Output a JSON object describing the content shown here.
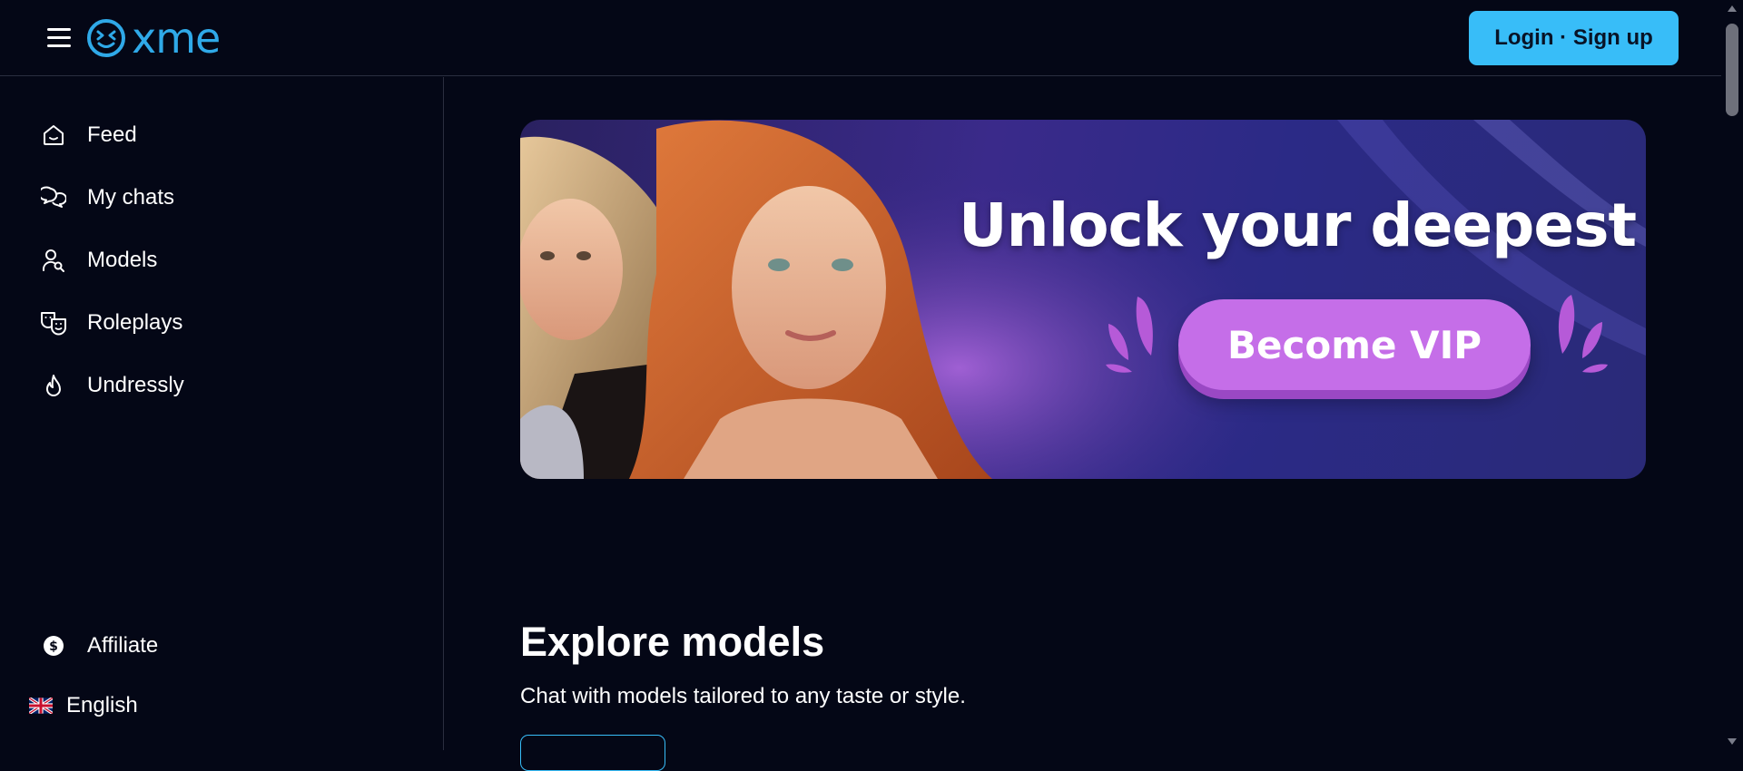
{
  "header": {
    "logo_text": "xme",
    "login_label": "Login · Sign up"
  },
  "sidebar": {
    "items": [
      {
        "label": "Feed",
        "icon": "home-icon"
      },
      {
        "label": "My chats",
        "icon": "chat-bubbles-icon"
      },
      {
        "label": "Models",
        "icon": "user-search-icon"
      },
      {
        "label": "Roleplays",
        "icon": "theater-masks-icon"
      },
      {
        "label": "Undressly",
        "icon": "flame-icon"
      }
    ],
    "affiliate": {
      "label": "Affiliate",
      "icon": "dollar-coin-icon"
    },
    "language": {
      "label": "English",
      "icon": "uk-flag-icon"
    }
  },
  "banner": {
    "headline": "Unlock your deepest des",
    "cta_label": "Become VIP"
  },
  "explore": {
    "title": "Explore models",
    "subtitle": "Chat with models tailored to any taste or style."
  },
  "colors": {
    "background": "#040716",
    "accent": "#38bdf8",
    "logo": "#2fa9e8",
    "vip_button": "#c56ee8"
  }
}
